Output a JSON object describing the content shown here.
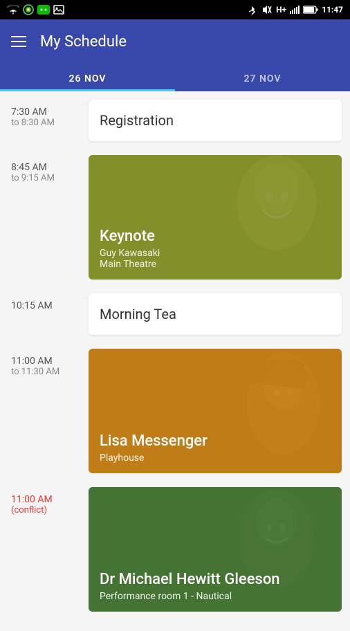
{
  "status": {
    "time": "11:47",
    "battery": "83%",
    "signal": "H+"
  },
  "header": {
    "title": "My Schedule",
    "menu_icon": "hamburger-icon"
  },
  "tabs": [
    {
      "label": "26 NOV",
      "active": true
    },
    {
      "label": "27 NOV",
      "active": false
    }
  ],
  "schedule": [
    {
      "time_start": "7:30 AM",
      "time_end": "to 8:30 AM",
      "type": "plain",
      "title": "Registration",
      "conflict": false
    },
    {
      "time_start": "8:45 AM",
      "time_end": "to 9:15 AM",
      "type": "image",
      "title": "Keynote",
      "subtitle_line1": "Guy Kawasaki",
      "subtitle_line2": "Main Theatre",
      "overlay": "keynote",
      "conflict": false
    },
    {
      "time_start": "10:15 AM",
      "time_end": "",
      "type": "plain",
      "title": "Morning Tea",
      "conflict": false
    },
    {
      "time_start": "11:00 AM",
      "time_end": "to 11:30 AM",
      "type": "image",
      "title": "Lisa Messenger",
      "subtitle_line1": "",
      "subtitle_line2": "Playhouse",
      "overlay": "lisa",
      "conflict": false
    },
    {
      "time_start": "11:00 AM",
      "time_end": "(conflict)",
      "type": "image",
      "title": "Dr Michael Hewitt Gleeson",
      "subtitle_line1": "",
      "subtitle_line2": "Performance room 1 - Nautical",
      "overlay": "michael",
      "conflict": true
    }
  ]
}
